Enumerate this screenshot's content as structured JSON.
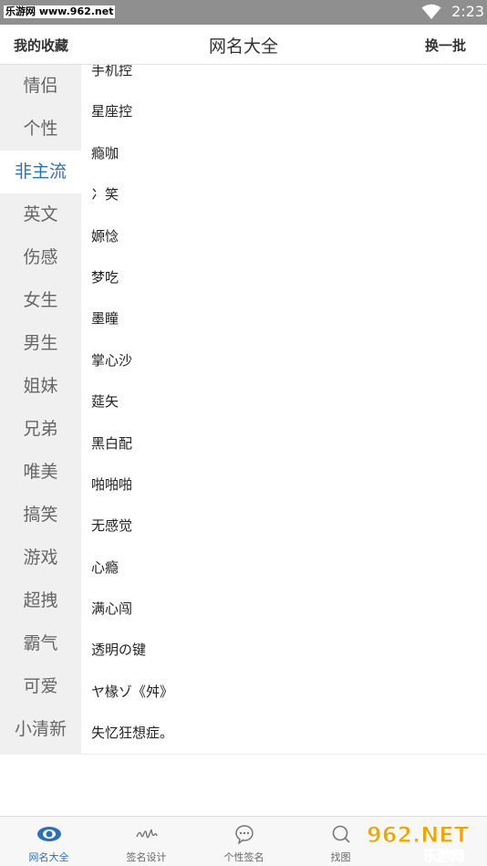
{
  "status_bar": {
    "watermark": "乐游网 www.962.net",
    "time": "2:23"
  },
  "header": {
    "left": "我的收藏",
    "title": "网名大全",
    "right": "换一批"
  },
  "sidebar": {
    "items": [
      {
        "label": "情侣",
        "active": false
      },
      {
        "label": "个性",
        "active": false
      },
      {
        "label": "非主流",
        "active": true
      },
      {
        "label": "英文",
        "active": false
      },
      {
        "label": "伤感",
        "active": false
      },
      {
        "label": "女生",
        "active": false
      },
      {
        "label": "男生",
        "active": false
      },
      {
        "label": "姐妹",
        "active": false
      },
      {
        "label": "兄弟",
        "active": false
      },
      {
        "label": "唯美",
        "active": false
      },
      {
        "label": "搞笑",
        "active": false
      },
      {
        "label": "游戏",
        "active": false
      },
      {
        "label": "超拽",
        "active": false
      },
      {
        "label": "霸气",
        "active": false
      },
      {
        "label": "可爱",
        "active": false
      },
      {
        "label": "小清新",
        "active": false
      }
    ]
  },
  "names": [
    "手机控",
    "星座控",
    "瘾咖",
    "冫笑",
    "嫄惗",
    "梦吃",
    "墨瞳",
    "掌心沙",
    "莚矢",
    "黑白配",
    "啪啪啪",
    "无感觉",
    "心瘾",
    "满心闯",
    "透明の键",
    "ヤ椽ゾ《舛》",
    "失忆狂想症。"
  ],
  "bottom_nav": {
    "items": [
      {
        "label": "网名大全",
        "icon": "eye-icon",
        "active": true
      },
      {
        "label": "签名设计",
        "icon": "signature-icon",
        "active": false
      },
      {
        "label": "个性签名",
        "icon": "chat-bubble-icon",
        "active": false
      },
      {
        "label": "找图",
        "icon": "search-icon",
        "active": false
      }
    ]
  },
  "logo_watermark": {
    "top": "962.NET",
    "bottom": "乐游网"
  },
  "colors": {
    "accent": "#2b6fc3",
    "status_bar": "#8f8f8f",
    "sidebar_bg": "#f0f0f0"
  }
}
